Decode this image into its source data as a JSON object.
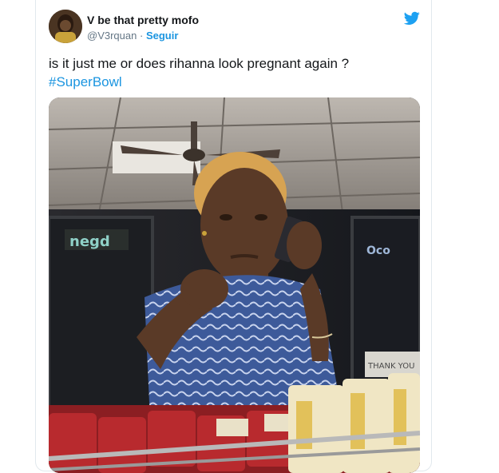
{
  "tweet": {
    "author_name": "V be that pretty mofo",
    "handle": "@V3rquan",
    "separator": "·",
    "follow_label": "Seguir",
    "text": "is it just me or does rihanna look pregnant again ?",
    "hashtag": "#SuperBowl"
  },
  "media": {
    "store_sign_text": "negd",
    "window_sign_text": "Oco",
    "counter_sign_text": "THANK YOU"
  },
  "colors": {
    "twitter_blue": "#1da1f2",
    "link_blue": "#1b95e0",
    "text": "#14171a",
    "muted": "#657786"
  },
  "icons": {
    "brand": "twitter-bird-icon"
  }
}
